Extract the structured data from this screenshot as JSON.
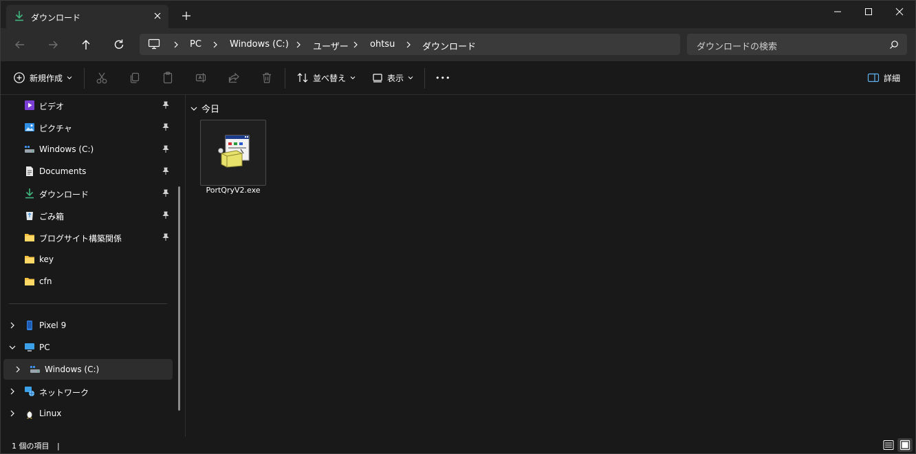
{
  "titlebar": {
    "tab_title": "ダウンロード",
    "new_tab_label": "+"
  },
  "nav": {
    "breadcrumbs": [
      "PC",
      "Windows (C:)",
      "ユーザー",
      "ohtsu",
      "ダウンロード"
    ],
    "search_placeholder": "ダウンロードの検索"
  },
  "commandbar": {
    "new_label": "新規作成",
    "sort_label": "並べ替え",
    "view_label": "表示",
    "more_label": "•••",
    "details_label": "詳細"
  },
  "sidebar": {
    "quick_access": [
      {
        "label": "ビデオ",
        "icon": "video-icon",
        "pinned": true
      },
      {
        "label": "ピクチャ",
        "icon": "pictures-icon",
        "pinned": true
      },
      {
        "label": "Windows (C:)",
        "icon": "drive-icon",
        "pinned": true
      },
      {
        "label": "Documents",
        "icon": "document-icon",
        "pinned": true
      },
      {
        "label": "ダウンロード",
        "icon": "download-icon",
        "pinned": true
      },
      {
        "label": "ごみ箱",
        "icon": "recycle-bin-icon",
        "pinned": true
      },
      {
        "label": "ブログサイト構築関係",
        "icon": "folder-icon",
        "pinned": true
      },
      {
        "label": "key",
        "icon": "folder-icon",
        "pinned": false
      },
      {
        "label": "cfn",
        "icon": "folder-icon",
        "pinned": false
      }
    ],
    "devices": [
      {
        "label": "Pixel 9",
        "icon": "phone-icon",
        "expanded": false
      },
      {
        "label": "PC",
        "icon": "pc-icon",
        "expanded": true
      },
      {
        "label": "Windows (C:)",
        "icon": "drive-icon",
        "expanded": false,
        "selected": true
      },
      {
        "label": "ネットワーク",
        "icon": "network-icon",
        "expanded": false
      },
      {
        "label": "Linux",
        "icon": "linux-icon",
        "expanded": false
      }
    ]
  },
  "content": {
    "group_label": "今日",
    "files": [
      {
        "name": "PortQryV2.exe",
        "icon": "installer-icon"
      }
    ]
  },
  "statusbar": {
    "item_count": "1 個の項目",
    "separator": "|"
  },
  "colors": {
    "background": "#191919",
    "titlebar": "#202020",
    "tab": "#2c2c2c",
    "accent_green": "#3fb77e",
    "folder_yellow": "#f5c242"
  }
}
